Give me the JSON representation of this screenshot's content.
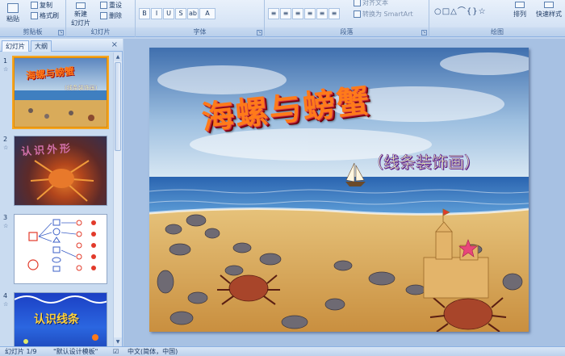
{
  "ribbon": {
    "groups": {
      "clipboard": "剪贴板",
      "slides": "幻灯片",
      "font": "字体",
      "paragraph": "段落",
      "drawing": "绘图"
    },
    "clipboard": {
      "paste": "粘贴",
      "copy": "复制",
      "format_painter": "格式刷"
    },
    "slides": {
      "new_slide_1": "新建",
      "new_slide_2": "幻灯片",
      "reset": "重设",
      "delete": "删除"
    },
    "paragraph": {
      "text_direction": "对齐文本",
      "convert_smartart": "转换为 SmartArt"
    },
    "drawing": {
      "arrange": "排列",
      "quick_styles": "快速样式"
    },
    "font_buttons": [
      "B",
      "I",
      "U",
      "S",
      "ab",
      "A"
    ],
    "paragraph_buttons": [
      "≡",
      "≡",
      "≡",
      "≡",
      "≡",
      "≡"
    ]
  },
  "left_pane": {
    "tabs": [
      "幻灯片",
      "大纲"
    ],
    "close": "×",
    "thumbnails": [
      {
        "number": "1",
        "title": "海螺与螃蟹",
        "subtitle": "(线条装饰画)",
        "selected": true
      },
      {
        "number": "2",
        "title": "认识外形",
        "selected": false
      },
      {
        "number": "3",
        "selected": false
      },
      {
        "number": "4",
        "title": "认识线条",
        "selected": false
      }
    ]
  },
  "slide": {
    "title": "海螺与螃蟹",
    "subtitle": "（线条装饰画）"
  },
  "statusbar": {
    "slide_index": "幻灯片 1/9",
    "theme": "\"默认设计模板\"",
    "language": "中文(简体，中国)"
  },
  "colors": {
    "title_orange": "#ff7a1a",
    "subtitle_yellow": "#f0ffb8",
    "selection": "#f5a623"
  }
}
